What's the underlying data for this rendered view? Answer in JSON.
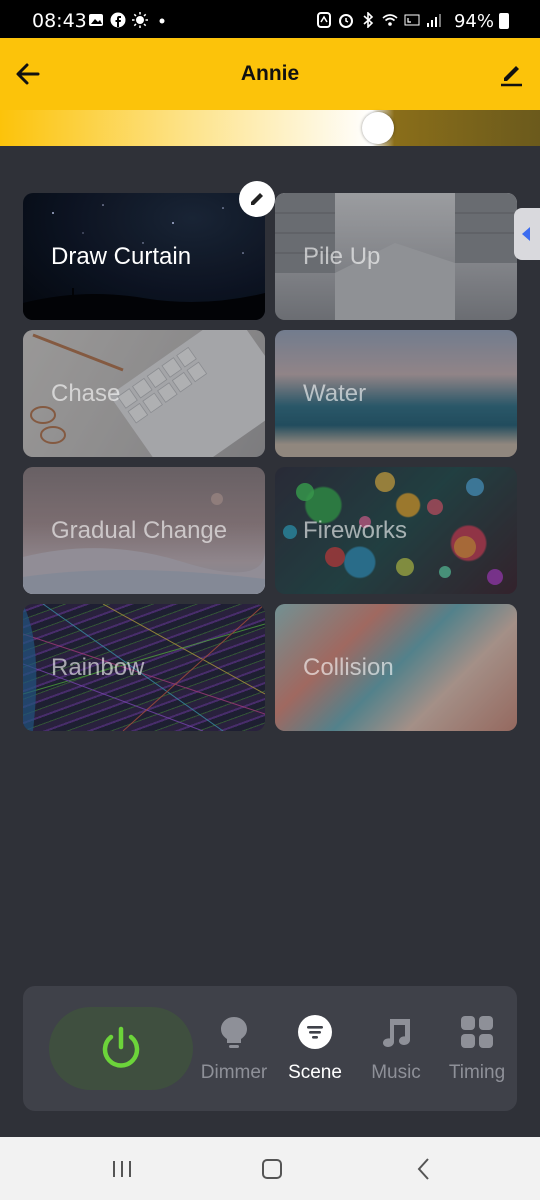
{
  "status_bar": {
    "time": "08:43",
    "battery": "94%",
    "left_icons": [
      "gallery-icon",
      "facebook-icon",
      "brightness-icon",
      "dot-icon"
    ],
    "right_icons": [
      "nfc-icon",
      "alarm-icon",
      "bluetooth-icon",
      "wifi-icon",
      "volte-icon",
      "signal-icon"
    ]
  },
  "header": {
    "title": "Annie",
    "accent_color": "#fcc30a"
  },
  "brightness": {
    "level": 0.7
  },
  "scenes": [
    {
      "label": "Draw Curtain",
      "active": true
    },
    {
      "label": "Pile Up",
      "active": false
    },
    {
      "label": "Chase",
      "active": false
    },
    {
      "label": "Water",
      "active": false
    },
    {
      "label": "Gradual Change",
      "active": false
    },
    {
      "label": "Fireworks",
      "active": false
    },
    {
      "label": "Rainbow",
      "active": false
    },
    {
      "label": "Collision",
      "active": false
    }
  ],
  "bottom_nav": {
    "power_color": "#6cd43a",
    "items": [
      {
        "label": "Dimmer",
        "icon": "bulb-icon",
        "active": false
      },
      {
        "label": "Scene",
        "icon": "scene-icon",
        "active": true
      },
      {
        "label": "Music",
        "icon": "music-icon",
        "active": false
      },
      {
        "label": "Timing",
        "icon": "grid-icon",
        "active": false
      }
    ]
  }
}
